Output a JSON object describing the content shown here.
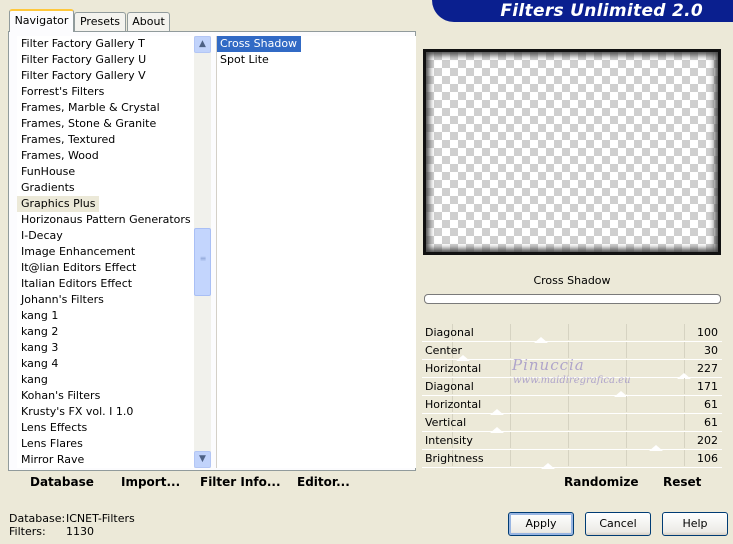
{
  "title": "Filters Unlimited 2.0",
  "tabs": [
    {
      "label": "Navigator",
      "active": true
    },
    {
      "label": "Presets",
      "active": false
    },
    {
      "label": "About",
      "active": false
    }
  ],
  "categories": [
    "Filter Factory Gallery T",
    "Filter Factory Gallery U",
    "Filter Factory Gallery V",
    "Forrest's Filters",
    "Frames, Marble & Crystal",
    "Frames, Stone & Granite",
    "Frames, Textured",
    "Frames, Wood",
    "FunHouse",
    "Gradients",
    "Graphics Plus",
    "Horizonaus Pattern Generators",
    "I-Decay",
    "Image Enhancement",
    "It@lian Editors Effect",
    "Italian Editors Effect",
    "Johann's Filters",
    "kang 1",
    "kang 2",
    "kang 3",
    "kang 4",
    "kang",
    "Kohan's Filters",
    "Krusty's FX vol. I 1.0",
    "Lens Effects",
    "Lens Flares",
    "Mirror Rave"
  ],
  "selected_category": "Graphics Plus",
  "filters": [
    "Cross Shadow",
    "Spot Lite"
  ],
  "selected_filter": "Cross Shadow",
  "filter_name": "Cross Shadow",
  "progress": 0,
  "params": [
    {
      "label": "Diagonal",
      "value": "100",
      "level": 100
    },
    {
      "label": "Center",
      "value": "30",
      "level": 30
    },
    {
      "label": "Horizontal",
      "value": "227",
      "level": 227
    },
    {
      "label": "Diagonal",
      "value": "171",
      "level": 171
    },
    {
      "label": "Horizontal",
      "value": "61",
      "level": 61
    },
    {
      "label": "Vertical",
      "value": "61",
      "level": 61
    },
    {
      "label": "Intensity",
      "value": "202",
      "level": 202
    },
    {
      "label": "Brightness",
      "value": "106",
      "level": 106
    }
  ],
  "toolbar": {
    "database": "Database",
    "import": "Import...",
    "filter_info": "Filter Info...",
    "editor": "Editor...",
    "randomize": "Randomize",
    "reset": "Reset"
  },
  "watermark": {
    "name": "Pinuccia",
    "url": "www.maidiregrafica.eu"
  },
  "footer": {
    "database_label": "Database:",
    "database_value": "ICNET-Filters",
    "filters_label": "Filters:",
    "filters_value": "1130"
  },
  "buttons": {
    "apply": "Apply",
    "cancel": "Cancel",
    "help": "Help"
  },
  "icons": {
    "scroll_up": "chevron-up-icon",
    "scroll_down": "chevron-down-icon"
  }
}
